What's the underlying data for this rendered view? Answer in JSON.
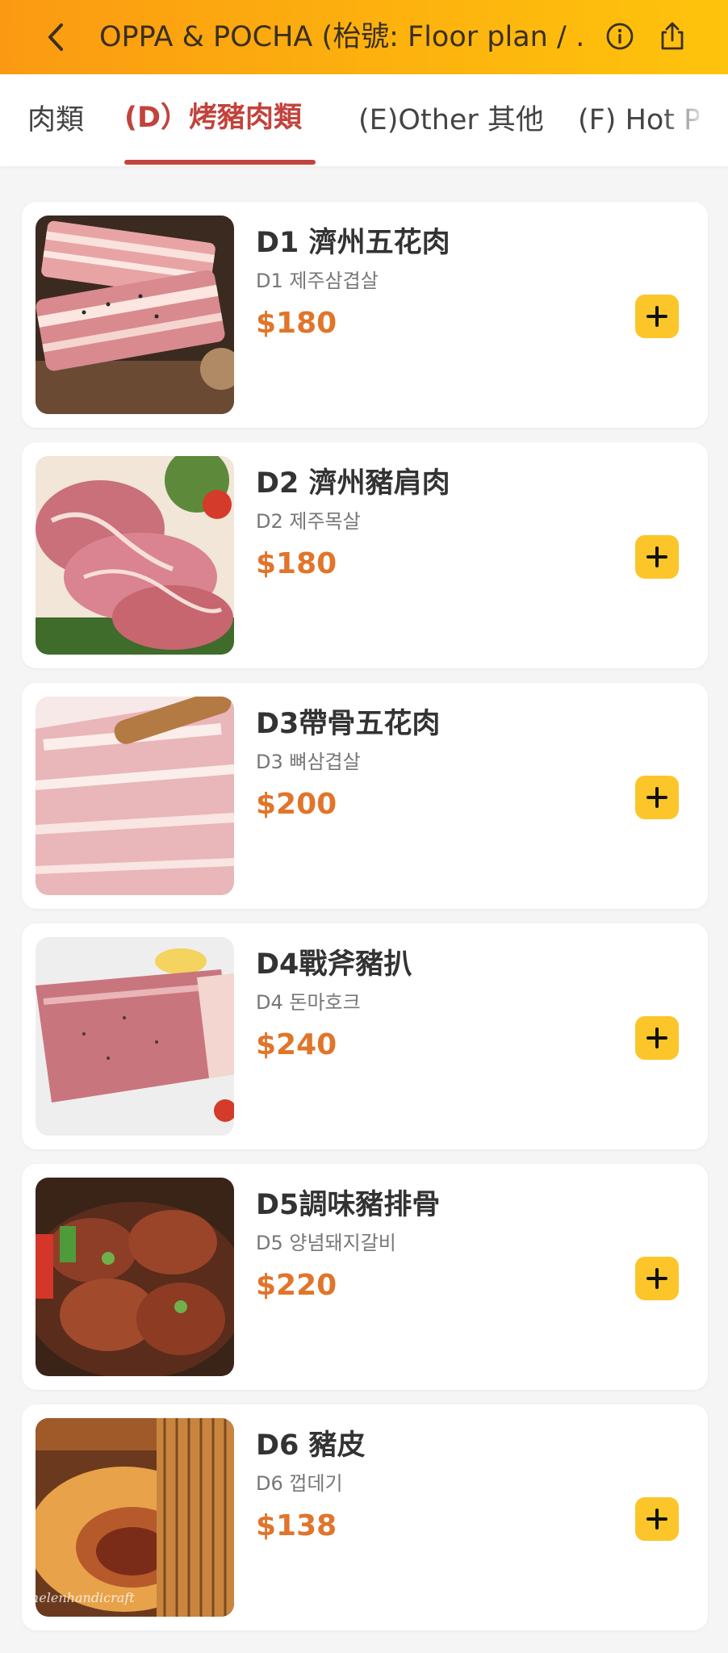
{
  "header": {
    "title": "OPPA & POCHA (枱號: Floor plan / …",
    "back_icon": "chevron-left-icon",
    "info_icon": "info-icon",
    "share_icon": "share-icon"
  },
  "tabs": [
    {
      "label": "肉類",
      "active": false
    },
    {
      "label": "(D）烤豬肉類",
      "active": true
    },
    {
      "label": "(E)Other 其他",
      "active": false
    },
    {
      "label": "(F) Hot Pot",
      "active": false
    }
  ],
  "colors": {
    "accent": "#c2433d",
    "price": "#e0752b",
    "add_button": "#fcc52a",
    "header_start": "#fb9a12",
    "header_end": "#fec30c"
  },
  "items": [
    {
      "name": "D1 濟州五花肉",
      "subtitle": "D1 제주삼겹살",
      "price": "$180"
    },
    {
      "name": "D2 濟州豬肩肉",
      "subtitle": "D2 제주목살",
      "price": "$180"
    },
    {
      "name": "D3帶骨五花肉",
      "subtitle": "D3 뼈삼겹살",
      "price": "$200"
    },
    {
      "name": "D4戰斧豬扒",
      "subtitle": "D4 돈마호크",
      "price": "$240"
    },
    {
      "name": "D5調味豬排骨",
      "subtitle": "D5 양념돼지갈비",
      "price": "$220"
    },
    {
      "name": "D6 豬皮",
      "subtitle": "D6 껍데기",
      "price": "$138"
    }
  ],
  "watermark": "helenhandicraft"
}
